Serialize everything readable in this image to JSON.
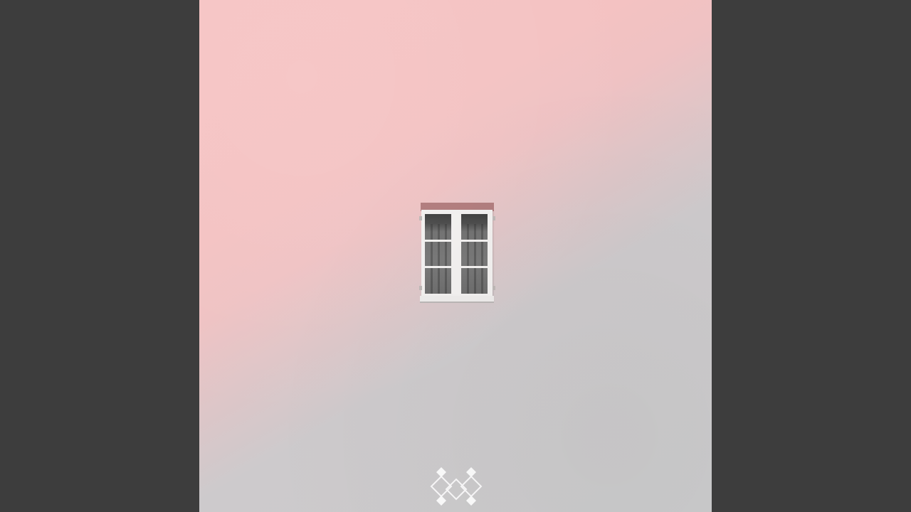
{
  "scene": {
    "description_colors": {
      "outside_background": "#3d3d3d",
      "wall_top": "#f6c3c3",
      "wall_bottom": "#cbcbcc",
      "window_frame": "#f2f0ef",
      "lintel": "#b07a7b",
      "glass_curtain": "#707070"
    },
    "icons": {
      "logo": "diamond-pattern-logo"
    }
  }
}
